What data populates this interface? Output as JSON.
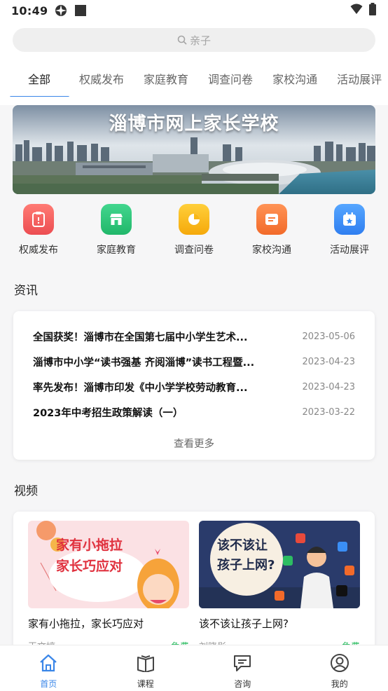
{
  "status_bar": {
    "time": "10:49",
    "left_icons": [
      "sync-icon",
      "square-icon"
    ],
    "right_icons": [
      "wifi-icon",
      "battery-icon"
    ]
  },
  "search": {
    "placeholder": "亲子",
    "icon": "search-icon"
  },
  "tabs": [
    {
      "label": "全部",
      "active": true
    },
    {
      "label": "权威发布",
      "active": false
    },
    {
      "label": "家庭教育",
      "active": false
    },
    {
      "label": "调查问卷",
      "active": false
    },
    {
      "label": "家校沟通",
      "active": false
    },
    {
      "label": "活动展评",
      "active": false
    }
  ],
  "banner": {
    "title": "淄博市网上家长学校"
  },
  "quick_menu": [
    {
      "label": "权威发布",
      "icon": "clipboard-icon",
      "color": "#f2615e"
    },
    {
      "label": "家庭教育",
      "icon": "store-icon",
      "color": "#2fc97e"
    },
    {
      "label": "调查问卷",
      "icon": "pie-chart-icon",
      "color": "#f8b718"
    },
    {
      "label": "家校沟通",
      "icon": "message-icon",
      "color": "#fa7a3b"
    },
    {
      "label": "活动展评",
      "icon": "calendar-icon",
      "color": "#3a8ef5"
    }
  ],
  "news": {
    "section_title": "资讯",
    "items": [
      {
        "title": "全国获奖！淄博市在全国第七届中小学生艺术...",
        "date": "2023-05-06"
      },
      {
        "title": "淄博市中小学“读书强基 齐阅淄博”读书工程暨...",
        "date": "2023-04-23"
      },
      {
        "title": "率先发布！淄博市印发《中小学学校劳动教育...",
        "date": "2023-04-23"
      },
      {
        "title": "2023年中考招生政策解读（一）",
        "date": "2023-03-22"
      }
    ],
    "more_label": "查看更多"
  },
  "videos": {
    "section_title": "视频",
    "items": [
      {
        "title": "家有小拖拉，家长巧应对",
        "author": "王文婷",
        "price": "免费",
        "thumb_text": [
          "家有小拖拉",
          "家长巧应对"
        ]
      },
      {
        "title": "该不该让孩子上网?",
        "author": "刘晓彤",
        "price": "免费",
        "thumb_text": [
          "该不该让",
          "孩子上网?"
        ]
      }
    ]
  },
  "bottom_nav": [
    {
      "label": "首页",
      "icon": "home-icon",
      "active": true
    },
    {
      "label": "课程",
      "icon": "book-icon",
      "active": false
    },
    {
      "label": "咨询",
      "icon": "chat-icon",
      "active": false
    },
    {
      "label": "我的",
      "icon": "user-icon",
      "active": false
    }
  ],
  "colors": {
    "accent": "#3a86e8",
    "free": "#2dbd62"
  }
}
